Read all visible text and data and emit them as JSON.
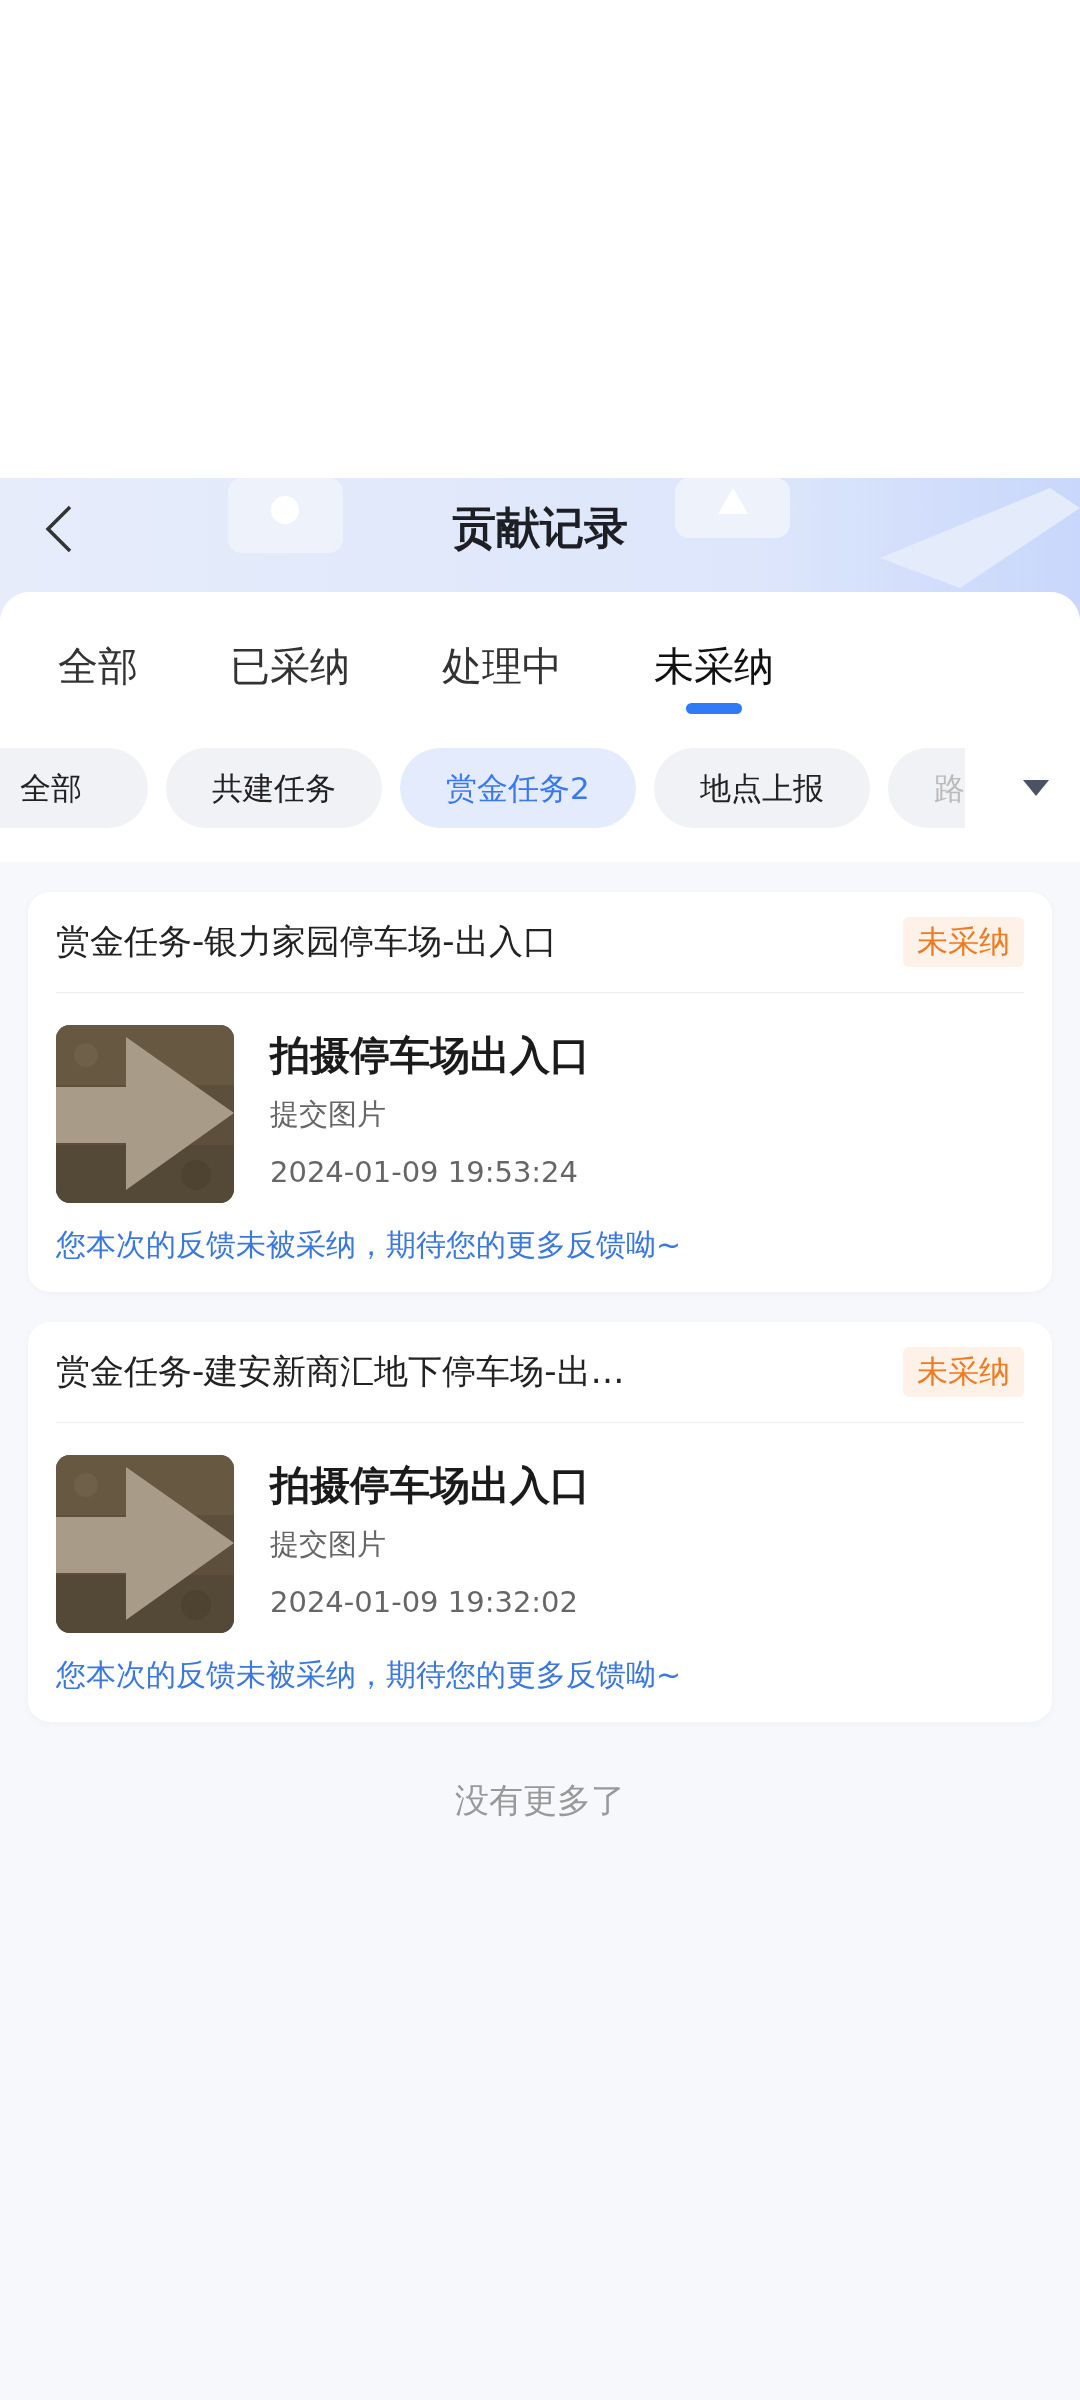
{
  "header": {
    "title": "贡献记录"
  },
  "tabs": [
    {
      "label": "全部",
      "selected": false
    },
    {
      "label": "已采纳",
      "selected": false
    },
    {
      "label": "处理中",
      "selected": false
    },
    {
      "label": "未采纳",
      "selected": true
    }
  ],
  "filters": [
    {
      "label": "全部",
      "selected": false
    },
    {
      "label": "共建任务",
      "selected": false
    },
    {
      "label": "赏金任务2",
      "selected": true
    },
    {
      "label": "地点上报",
      "selected": false
    },
    {
      "label": "路",
      "selected": false
    }
  ],
  "records": [
    {
      "title": "赏金任务-银力家园停车场-出入口",
      "status": "未采纳",
      "task": "拍摄停车场出入口",
      "type": "提交图片",
      "time": "2024-01-09 19:53:24",
      "feedback": "您本次的反馈未被采纳，期待您的更多反馈呦~"
    },
    {
      "title": "赏金任务-建安新商汇地下停车场-出…",
      "status": "未采纳",
      "task": "拍摄停车场出入口",
      "type": "提交图片",
      "time": "2024-01-09 19:32:02",
      "feedback": "您本次的反馈未被采纳，期待您的更多反馈呦~"
    }
  ],
  "footer": "没有更多了"
}
